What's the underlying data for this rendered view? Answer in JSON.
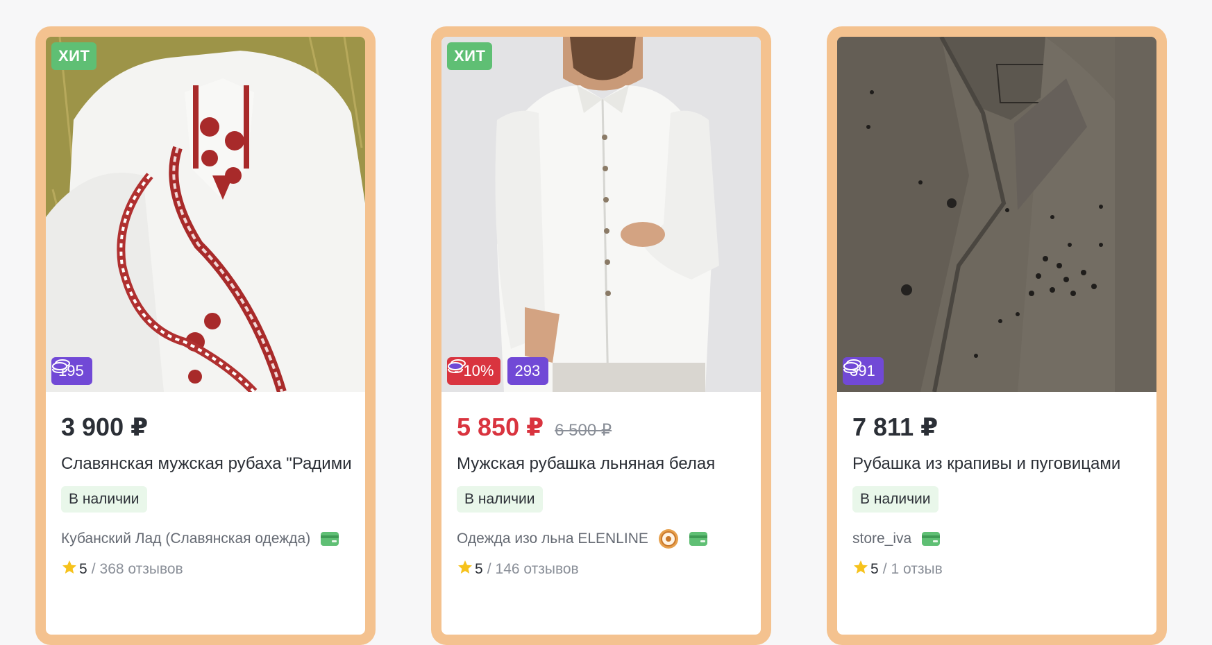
{
  "colors": {
    "card_border": "#f4c28f",
    "hit_badge": "#5fbf74",
    "discount_badge": "#d9343f",
    "coins_badge": "#7149d6",
    "stock_badge": "#e9f7ea",
    "sale_price": "#d9343f"
  },
  "products": [
    {
      "hit_label": "ХИТ",
      "coins": "195",
      "discount": null,
      "price": "3 900 ₽",
      "old_price": null,
      "title": "Славянская мужская рубаха \"Радимир\"",
      "stock": "В наличии",
      "seller": "Кубанский Лад (Славянская одежда)",
      "rating": "5",
      "rating_sep": "/",
      "reviews": "368 отзывов",
      "icons": [
        "coins-icon",
        "card-icon",
        "star-icon"
      ]
    },
    {
      "hit_label": "ХИТ",
      "coins": "293",
      "discount": "- 10%",
      "price": "5 850 ₽",
      "old_price": "6 500 ₽",
      "title": "Мужская рубашка льняная белая",
      "stock": "В наличии",
      "seller": "Одежда изо льна ELENLINE",
      "rating": "5",
      "rating_sep": "/",
      "reviews": "146 отзывов",
      "icons": [
        "coins-icon",
        "seller-badge-icon",
        "card-icon",
        "star-icon"
      ]
    },
    {
      "hit_label": null,
      "coins": "391",
      "discount": null,
      "price": "7 811 ₽",
      "old_price": null,
      "title": "Рубашка из крапивы и пуговицами",
      "stock": "В наличии",
      "seller": "store_iva",
      "rating": "5",
      "rating_sep": "/",
      "reviews": "1 отзыв",
      "icons": [
        "coins-icon",
        "card-icon",
        "star-icon"
      ]
    }
  ]
}
